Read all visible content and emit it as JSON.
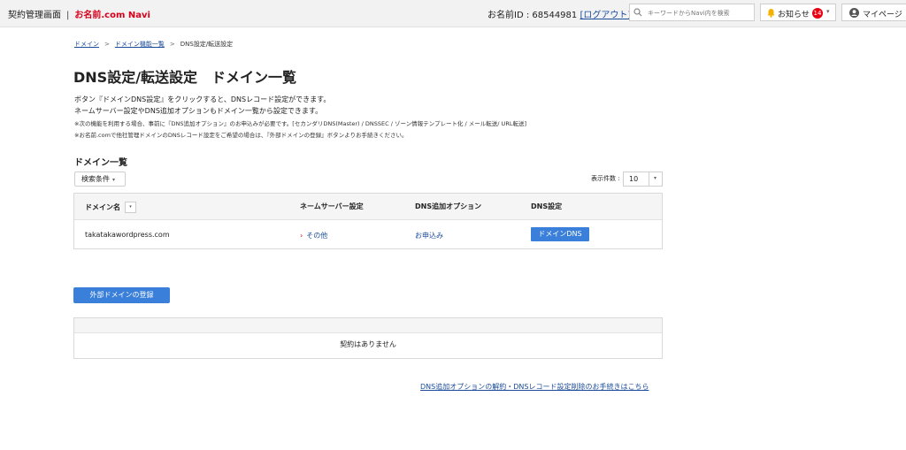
{
  "header": {
    "title": "契約管理画面",
    "brand": "お名前.com Navi",
    "account_label": "お名前ID : 68544981",
    "logout": "[ログアウト]",
    "search_placeholder": "キーワードからNavi内を検索",
    "notice_label": "お知らせ",
    "notice_count": "14",
    "mypage_label": "マイページ"
  },
  "breadcrumb": {
    "items": [
      "ドメイン",
      "ドメイン機能一覧",
      "DNS設定/転送設定"
    ]
  },
  "page_title": "DNS設定/転送設定　ドメイン一覧",
  "description": {
    "line1": "ボタン『ドメインDNS設定』をクリックすると、DNSレコード設定ができます。",
    "line2": "ネームサーバー設定やDNS追加オプションもドメイン一覧から設定できます。",
    "note1": "※次の機能を利用する場合、事前に『DNS追加オプション』のお申込みが必要です。[セカンダリDNS(Master) / DNSSEC / ゾーン情報テンプレート化 / メール転送/ URL転送]",
    "note2": "※お名前.comで他社管理ドメインのDNSレコード設定をご希望の場合は、『外部ドメインの登録』ボタンよりお手続きください。"
  },
  "domain_list": {
    "heading": "ドメイン一覧",
    "search_condition": "検索条件",
    "per_page_label": "表示件数 :",
    "per_page_value": "10",
    "columns": [
      "ドメイン名",
      "ネームサーバー設定",
      "DNS追加オプション",
      "DNS設定"
    ],
    "rows": [
      {
        "domain": "takatakawordpress.com",
        "nameserver": "その他",
        "dns_option": "お申込み",
        "dns_button": "ドメインDNS"
      }
    ]
  },
  "external": {
    "button": "外部ドメインの登録",
    "empty_message": "契約はありません"
  },
  "footer_link": "DNS追加オプションの解約・DNSレコード設定削除のお手続きはこちら",
  "icons": [
    "search-icon",
    "bell-icon",
    "chevron-down-icon",
    "user-icon",
    "sort-icon",
    "arrow-right-icon"
  ],
  "colors": {
    "brand_red": "#d7001b",
    "button_blue": "#3a7fd9",
    "link_blue": "#1a4b9a",
    "badge_red": "#e60012",
    "bell_yellow": "#f3b200"
  }
}
